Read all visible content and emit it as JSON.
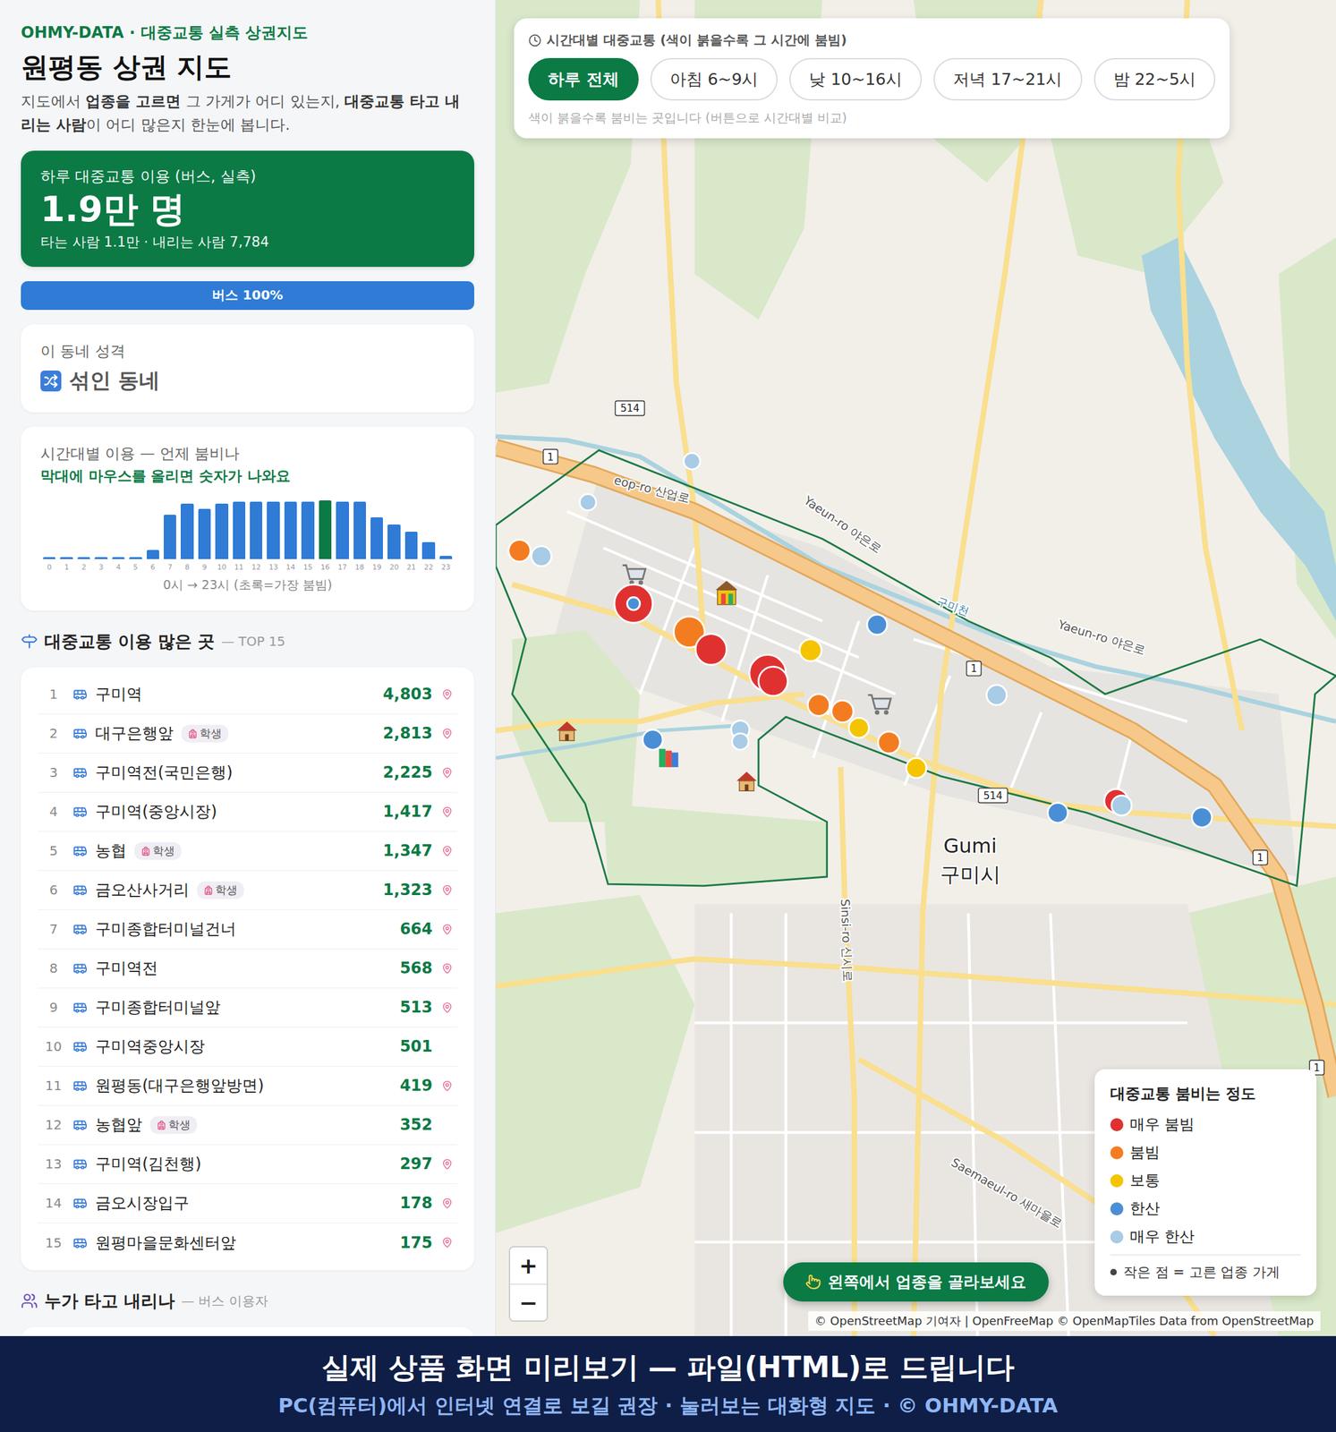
{
  "brand": "OHMY-DATA · 대중교통 실측 상권지도",
  "title": "원평동 상권 지도",
  "description": [
    {
      "text": "지도에서 ",
      "bold": false
    },
    {
      "text": "업종을 고르면",
      "bold": true
    },
    {
      "text": " 그 가게가 어디 있는지, ",
      "bold": false
    },
    {
      "text": "대중교통 타고 내리는 사람",
      "bold": true
    },
    {
      "text": "이 어디 많은지 한눈에 봅니다.",
      "bold": false
    }
  ],
  "summary": {
    "label": "하루 대중교통 이용 (버스, 실측)",
    "value": "1.9만 명",
    "detail": "타는 사람 1.1만 · 내리는 사람 7,784"
  },
  "mode_share": [
    {
      "label": "버스 100%",
      "level": 1,
      "color": "#2f7bd6"
    }
  ],
  "character": {
    "label": "이 동네 성격",
    "value": "섞인 동네"
  },
  "hourly_chart": {
    "title": "시간대별 이용 — 언제 붐비나",
    "hint": "막대에 마우스를 올리면 숫자가 나와요",
    "values": [
      40,
      40,
      40,
      40,
      40,
      40,
      215,
      1030,
      1290,
      1180,
      1290,
      1350,
      1350,
      1350,
      1350,
      1350,
      1380,
      1350,
      1350,
      970,
      800,
      645,
      390,
      65
    ],
    "ticks": [
      "0",
      "1",
      "2",
      "3",
      "4",
      "5",
      "6",
      "7",
      "8",
      "9",
      "10",
      "11",
      "12",
      "13",
      "14",
      "15",
      "16",
      "17",
      "18",
      "19",
      "20",
      "21",
      "22",
      "23"
    ],
    "caption": "0시 → 23시 (초록=가장 붐빔)"
  },
  "top_stops": {
    "title": "대중교통 이용 많은 곳",
    "subtitle": "— TOP 15",
    "rows": [
      {
        "rank": "1",
        "name": "구미역",
        "count": "4,803",
        "pinned": true
      },
      {
        "rank": "2",
        "name": "대구은행앞",
        "badge": "학생",
        "count": "2,813",
        "pinned": true
      },
      {
        "rank": "3",
        "name": "구미역전(국민은행)",
        "count": "2,225",
        "pinned": true
      },
      {
        "rank": "4",
        "name": "구미역(중앙시장)",
        "count": "1,417",
        "pinned": true
      },
      {
        "rank": "5",
        "name": "농협",
        "badge": "학생",
        "count": "1,347",
        "pinned": true
      },
      {
        "rank": "6",
        "name": "금오산사거리",
        "badge": "학생",
        "count": "1,323",
        "pinned": true
      },
      {
        "rank": "7",
        "name": "구미종합터미널건너",
        "count": "664",
        "pinned": true
      },
      {
        "rank": "8",
        "name": "구미역전",
        "count": "568",
        "pinned": true
      },
      {
        "rank": "9",
        "name": "구미종합터미널앞",
        "count": "513",
        "pinned": true
      },
      {
        "rank": "10",
        "name": "구미역중앙시장",
        "count": "501",
        "pinned": false
      },
      {
        "rank": "11",
        "name": "원평동(대구은행앞방면)",
        "count": "419",
        "pinned": true
      },
      {
        "rank": "12",
        "name": "농협앞",
        "badge": "학생",
        "count": "352",
        "pinned": false
      },
      {
        "rank": "13",
        "name": "구미역(김천행)",
        "count": "297",
        "pinned": true
      },
      {
        "rank": "14",
        "name": "금오시장입구",
        "count": "178",
        "pinned": true
      },
      {
        "rank": "15",
        "name": "원평마을문화센터앞",
        "count": "175",
        "pinned": true
      }
    ]
  },
  "who_rides": {
    "title": "누가 타고 내리나",
    "subtitle": "— 버스 이용자"
  },
  "map": {
    "time_filter": {
      "title": "시간대별 대중교통 (색이 붉을수록 그 시간에 붐빔)",
      "options": [
        {
          "label": "하루 전체",
          "selected": true
        },
        {
          "label": "아침 6~9시",
          "selected": false
        },
        {
          "label": "낮 10~16시",
          "selected": false
        },
        {
          "label": "저녁 17~21시",
          "selected": false
        },
        {
          "label": "밤 22~5시",
          "selected": false
        }
      ],
      "hint": "색이 붉을수록 붐비는 곳입니다 (버튼으로 시간대별 비교)"
    },
    "legend": {
      "title": "대중교통 붐비는 정도",
      "items": [
        {
          "label": "매우 붐빔",
          "color": "#e03131"
        },
        {
          "label": "붐빔",
          "color": "#f47c20"
        },
        {
          "label": "보통",
          "color": "#f5c400"
        },
        {
          "label": "한산",
          "color": "#4a8fd6"
        },
        {
          "label": "매우 한산",
          "color": "#a8cbe6"
        }
      ],
      "note": "작은 점 = 고른 업종 가게"
    },
    "zoom": [
      "+",
      "−"
    ],
    "cta": "왼쪽에서 업종을 골라보세요",
    "attribution": "© OpenStreetMap 기여자 | OpenFreeMap © OpenMapTiles Data from OpenStreetMap",
    "labels": [
      "eop-ro 산업로",
      "Yaeun-ro 야은로",
      "Yaeun-ro 야은로",
      "구미천",
      "Gumi",
      "구미시",
      "Sinsi-ro 신시로",
      "Saemaeul-ro 새마을로"
    ],
    "shields": [
      "514",
      "514",
      "1",
      "1",
      "1",
      "1"
    ],
    "stops": [
      {
        "color": "#e03131"
      },
      {
        "color": "#f47c20"
      },
      {
        "color": "#e03131"
      },
      {
        "color": "#e03131"
      },
      {
        "color": "#e03131"
      },
      {
        "color": "#f5c400"
      },
      {
        "color": "#4a8fd6"
      },
      {
        "color": "#f47c20"
      },
      {
        "color": "#f47c20"
      },
      {
        "color": "#f5c400"
      },
      {
        "color": "#f47c20"
      },
      {
        "color": "#f5c400"
      },
      {
        "color": "#f47c20"
      },
      {
        "color": "#a8cbe6"
      },
      {
        "color": "#a8cbe6"
      },
      {
        "color": "#a8cbe6"
      },
      {
        "color": "#4a8fd6"
      },
      {
        "color": "#a8cbe6"
      },
      {
        "color": "#a8cbe6"
      },
      {
        "color": "#a8cbe6"
      },
      {
        "color": "#4a8fd6"
      },
      {
        "color": "#e03131"
      },
      {
        "color": "#a8cbe6"
      },
      {
        "color": "#4a8fd6"
      },
      {
        "color": "#4a8fd6"
      }
    ]
  },
  "banner": {
    "title": "실제 상품 화면 미리보기 — 파일(HTML)로 드립니다",
    "subtitle": "PC(컴퓨터)에서 인터넷 연결로 보길 권장 · 눌러보는 대화형 지도 · © OHMY-DATA"
  }
}
